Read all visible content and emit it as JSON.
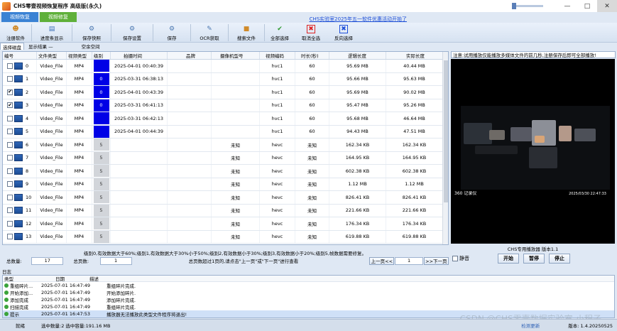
{
  "window": {
    "title": "CHS零壹视频恢复程序 高级版(永久)",
    "promo": "CHS实验室2025年五一软件优惠活动开始了"
  },
  "mode_tabs": [
    "视频恢复",
    "视频修复"
  ],
  "toolbar": [
    {
      "label": "注册软件",
      "icon": "user-icon"
    },
    {
      "label": "进度条显示",
      "icon": "progress-icon"
    },
    {
      "label": "保存快照",
      "icon": "snapshot-icon"
    },
    {
      "label": "保存设置",
      "icon": "settings-icon"
    },
    {
      "label": "保存",
      "icon": "save-icon"
    },
    {
      "label": "OCR获取",
      "icon": "ocr-icon"
    },
    {
      "label": "搜索文件",
      "icon": "search-icon"
    },
    {
      "label": "全部选择",
      "icon": "check-icon"
    },
    {
      "label": "取消全选",
      "icon": "cancel-icon"
    },
    {
      "label": "反向选择",
      "icon": "invert-icon"
    }
  ],
  "subtabs": {
    "tab": "选择磁盘",
    "result_label": "显示结果 —",
    "space_label": "空余空间"
  },
  "table": {
    "columns": [
      "编号",
      "文件类型",
      "视频类型",
      "级别",
      "拍摄时间",
      "品牌",
      "摄像机型号",
      "视频编码",
      "时长(秒)",
      "逻辑长度",
      "实际长度"
    ],
    "rows": [
      {
        "id": "0",
        "checked": false,
        "type": "Video_File",
        "vtype": "MP4",
        "level": "",
        "lc": "l0",
        "time": "2025-04-01 00:40:39",
        "brand": "",
        "model": "",
        "codec": "hvc1",
        "dur": "60",
        "logic": "95.69 MB",
        "actual": "40.44 MB"
      },
      {
        "id": "1",
        "checked": false,
        "type": "Video_File",
        "vtype": "MP4",
        "level": "0",
        "lc": "l0",
        "time": "2025-03-31 06:38:13",
        "brand": "",
        "model": "",
        "codec": "hvc1",
        "dur": "60",
        "logic": "95.66 MB",
        "actual": "95.63 MB"
      },
      {
        "id": "2",
        "checked": true,
        "type": "Video_File",
        "vtype": "MP4",
        "level": "0",
        "lc": "l0",
        "time": "2025-04-01 00:43:39",
        "brand": "",
        "model": "",
        "codec": "hvc1",
        "dur": "60",
        "logic": "95.69 MB",
        "actual": "90.02 MB"
      },
      {
        "id": "3",
        "checked": true,
        "type": "Video_File",
        "vtype": "MP4",
        "level": "0",
        "lc": "l0",
        "time": "2025-03-31 06:41:13",
        "brand": "",
        "model": "",
        "codec": "hvc1",
        "dur": "60",
        "logic": "95.47 MB",
        "actual": "95.26 MB"
      },
      {
        "id": "4",
        "checked": false,
        "type": "Video_File",
        "vtype": "MP4",
        "level": "",
        "lc": "l0",
        "time": "2025-03-31 06:42:13",
        "brand": "",
        "model": "",
        "codec": "hvc1",
        "dur": "60",
        "logic": "95.68 MB",
        "actual": "46.64 MB"
      },
      {
        "id": "5",
        "checked": false,
        "type": "Video_File",
        "vtype": "MP4",
        "level": "",
        "lc": "l0",
        "time": "2025-04-01 00:44:39",
        "brand": "",
        "model": "",
        "codec": "hvc1",
        "dur": "60",
        "logic": "94.43 MB",
        "actual": "47.51 MB"
      },
      {
        "id": "6",
        "checked": false,
        "type": "Video_File",
        "vtype": "MP4",
        "level": "5",
        "lc": "l5",
        "time": "",
        "brand": "",
        "model": "未知",
        "codec": "hevc",
        "dur": "未知",
        "logic": "162.34 KB",
        "actual": "162.34 KB"
      },
      {
        "id": "7",
        "checked": false,
        "type": "Video_File",
        "vtype": "MP4",
        "level": "5",
        "lc": "l5",
        "time": "",
        "brand": "",
        "model": "未知",
        "codec": "hevc",
        "dur": "未知",
        "logic": "164.95 KB",
        "actual": "164.95 KB"
      },
      {
        "id": "8",
        "checked": false,
        "type": "Video_File",
        "vtype": "MP4",
        "level": "5",
        "lc": "l5",
        "time": "",
        "brand": "",
        "model": "未知",
        "codec": "hevc",
        "dur": "未知",
        "logic": "602.38 KB",
        "actual": "602.38 KB"
      },
      {
        "id": "9",
        "checked": false,
        "type": "Video_File",
        "vtype": "MP4",
        "level": "5",
        "lc": "l5",
        "time": "",
        "brand": "",
        "model": "未知",
        "codec": "hevc",
        "dur": "未知",
        "logic": "1.12 MB",
        "actual": "1.12 MB"
      },
      {
        "id": "10",
        "checked": false,
        "type": "Video_File",
        "vtype": "MP4",
        "level": "5",
        "lc": "l5",
        "time": "",
        "brand": "",
        "model": "未知",
        "codec": "hevc",
        "dur": "未知",
        "logic": "826.41 KB",
        "actual": "826.41 KB"
      },
      {
        "id": "11",
        "checked": false,
        "type": "Video_File",
        "vtype": "MP4",
        "level": "5",
        "lc": "l5",
        "time": "",
        "brand": "",
        "model": "未知",
        "codec": "hevc",
        "dur": "未知",
        "logic": "221.66 KB",
        "actual": "221.66 KB"
      },
      {
        "id": "12",
        "checked": false,
        "type": "Video_File",
        "vtype": "MP4",
        "level": "5",
        "lc": "l5",
        "time": "",
        "brand": "",
        "model": "未知",
        "codec": "hevc",
        "dur": "未知",
        "logic": "176.34 KB",
        "actual": "176.34 KB"
      },
      {
        "id": "13",
        "checked": false,
        "type": "Video_File",
        "vtype": "MP4",
        "level": "5",
        "lc": "l5",
        "time": "",
        "brand": "",
        "model": "未知",
        "codec": "hevc",
        "dur": "未知",
        "logic": "619.88 KB",
        "actual": "619.88 KB"
      }
    ],
    "level_legend": "级别0,有效数据大于60%;级别1,有效数据大于30%小于50%;级别2,有效数据小于30%;级别3,有效数据小于20%;级别5,帧数据需要修复。"
  },
  "table_status": {
    "total_label": "总数量:",
    "total": "17",
    "pages_label": "总页数:",
    "pages": "1",
    "hint": "总页数超过1页的,请点击\"上一页\"或\"下一页\"进行查看",
    "prev": "上一页<<",
    "page_value": "1",
    "next": ">>下一页"
  },
  "preview": {
    "note": "注意:试用播放仅能播放多媒体文件的前几秒,注册保存后即可全部播放!",
    "cam_logo": "360 记录仪",
    "cam_time": "2025/03/30 22:47:33",
    "player_name": "CHS专用播放器 版本1.1",
    "mute_label": "静音",
    "play": "开始",
    "pause": "暂停",
    "stop": "停止"
  },
  "log": {
    "title": "日志",
    "columns": [
      "类型",
      "日期",
      "描述"
    ],
    "rows": [
      {
        "type": "重组碎片...",
        "date": "2025-07-01 16:47:49",
        "desc": "重组碎片完成."
      },
      {
        "type": "开始添加...",
        "date": "2025-07-01 16:47:49",
        "desc": "开始添加碎片."
      },
      {
        "type": "添加完成",
        "date": "2025-07-01 16:47:49",
        "desc": "添加碎片完成."
      },
      {
        "type": "扫描完成",
        "date": "2025-07-01 16:47:49",
        "desc": "重组碎片完成."
      },
      {
        "type": "提示",
        "date": "2025-07-01 16:47:53",
        "desc": "播放器无法播放此类型文件程序将退出!"
      }
    ]
  },
  "statusbar": {
    "state": "就绪",
    "selection": "选中数量:2 选中容量:191.16 MB",
    "update": "检测更新",
    "version": "版本: 1.4.20250525"
  },
  "watermark": "CSDN @CHS零壹数据实验室-小程子"
}
